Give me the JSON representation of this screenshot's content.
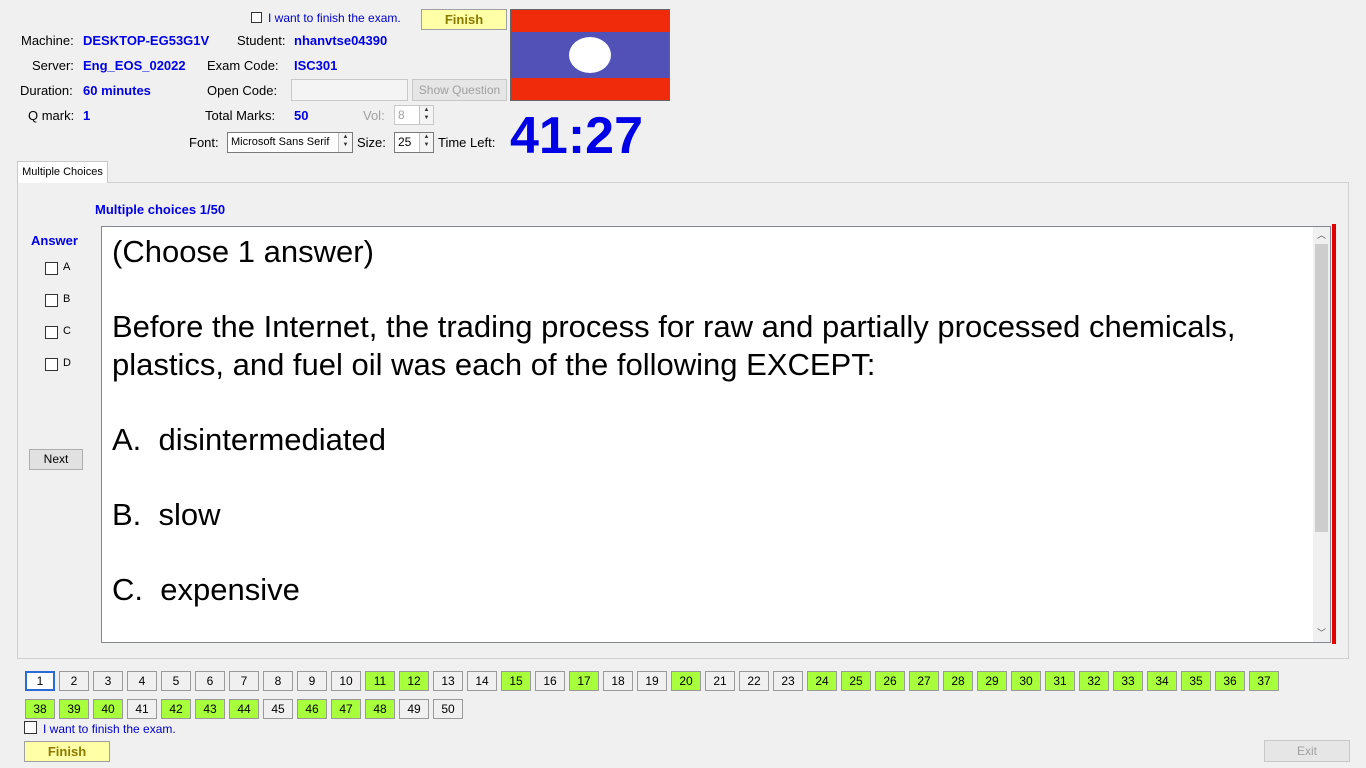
{
  "header": {
    "finish_checkbox_label": "I want to finish the exam.",
    "finish_button": "Finish",
    "machine_label": "Machine:",
    "machine_value": "DESKTOP-EG53G1V",
    "student_label": "Student:",
    "student_value": "nhanvtse04390",
    "server_label": "Server:",
    "server_value": "Eng_EOS_02022",
    "exam_code_label": "Exam Code:",
    "exam_code_value": "ISC301",
    "duration_label": "Duration:",
    "duration_value": "60 minutes",
    "open_code_label": "Open Code:",
    "open_code_value": "",
    "show_question_button": "Show Question",
    "qmark_label": "Q mark:",
    "qmark_value": "1",
    "total_marks_label": "Total Marks:",
    "total_marks_value": "50",
    "vol_label": "Vol:",
    "vol_value": "8",
    "font_label": "Font:",
    "font_value": "Microsoft Sans Serif",
    "size_label": "Size:",
    "size_value": "25",
    "time_left_label": "Time Left:",
    "time_left_value": "41:27"
  },
  "flag": {
    "top_color": "#ef2b0b",
    "middle_color": "#5151b7",
    "circle_color": "#ffffff"
  },
  "tabs": [
    {
      "label": "Multiple Choices",
      "active": true
    }
  ],
  "question": {
    "progress": "Multiple choices 1/50",
    "answer_label": "Answer",
    "options": [
      "A",
      "B",
      "C",
      "D"
    ],
    "next_button": "Next",
    "text": "(Choose 1 answer)\n\nBefore the Internet, the trading process for raw and partially processed chemicals, plastics, and fuel oil was each of the following EXCEPT:\n\nA.  disintermediated\n\nB.  slow\n\nC.  expensive"
  },
  "navigator": {
    "current": 1,
    "answered_color": "#a8ff3c",
    "row1": [
      {
        "n": "1",
        "answered": false
      },
      {
        "n": "2",
        "answered": false
      },
      {
        "n": "3",
        "answered": false
      },
      {
        "n": "4",
        "answered": false
      },
      {
        "n": "5",
        "answered": false
      },
      {
        "n": "6",
        "answered": false
      },
      {
        "n": "7",
        "answered": false
      },
      {
        "n": "8",
        "answered": false
      },
      {
        "n": "9",
        "answered": false
      },
      {
        "n": "10",
        "answered": false
      },
      {
        "n": "11",
        "answered": true
      },
      {
        "n": "12",
        "answered": true
      },
      {
        "n": "13",
        "answered": false
      },
      {
        "n": "14",
        "answered": false
      },
      {
        "n": "15",
        "answered": true
      },
      {
        "n": "16",
        "answered": false
      },
      {
        "n": "17",
        "answered": true
      },
      {
        "n": "18",
        "answered": false
      },
      {
        "n": "19",
        "answered": false
      },
      {
        "n": "20",
        "answered": true
      },
      {
        "n": "21",
        "answered": false
      },
      {
        "n": "22",
        "answered": false
      },
      {
        "n": "23",
        "answered": false
      },
      {
        "n": "24",
        "answered": true
      },
      {
        "n": "25",
        "answered": true
      },
      {
        "n": "26",
        "answered": true
      },
      {
        "n": "27",
        "answered": true
      },
      {
        "n": "28",
        "answered": true
      },
      {
        "n": "29",
        "answered": true
      },
      {
        "n": "30",
        "answered": true
      },
      {
        "n": "31",
        "answered": true
      },
      {
        "n": "32",
        "answered": true
      },
      {
        "n": "33",
        "answered": true
      },
      {
        "n": "34",
        "answered": true
      },
      {
        "n": "35",
        "answered": true
      },
      {
        "n": "36",
        "answered": true
      },
      {
        "n": "37",
        "answered": true
      }
    ],
    "row2": [
      {
        "n": "38",
        "answered": true
      },
      {
        "n": "39",
        "answered": true
      },
      {
        "n": "40",
        "answered": true
      },
      {
        "n": "41",
        "answered": false
      },
      {
        "n": "42",
        "answered": true
      },
      {
        "n": "43",
        "answered": true
      },
      {
        "n": "44",
        "answered": true
      },
      {
        "n": "45",
        "answered": false
      },
      {
        "n": "46",
        "answered": true
      },
      {
        "n": "47",
        "answered": true
      },
      {
        "n": "48",
        "answered": true
      },
      {
        "n": "49",
        "answered": false
      },
      {
        "n": "50",
        "answered": false
      }
    ]
  },
  "footer": {
    "finish_checkbox_label": "I want to finish the exam.",
    "finish_button": "Finish",
    "exit_button": "Exit"
  }
}
